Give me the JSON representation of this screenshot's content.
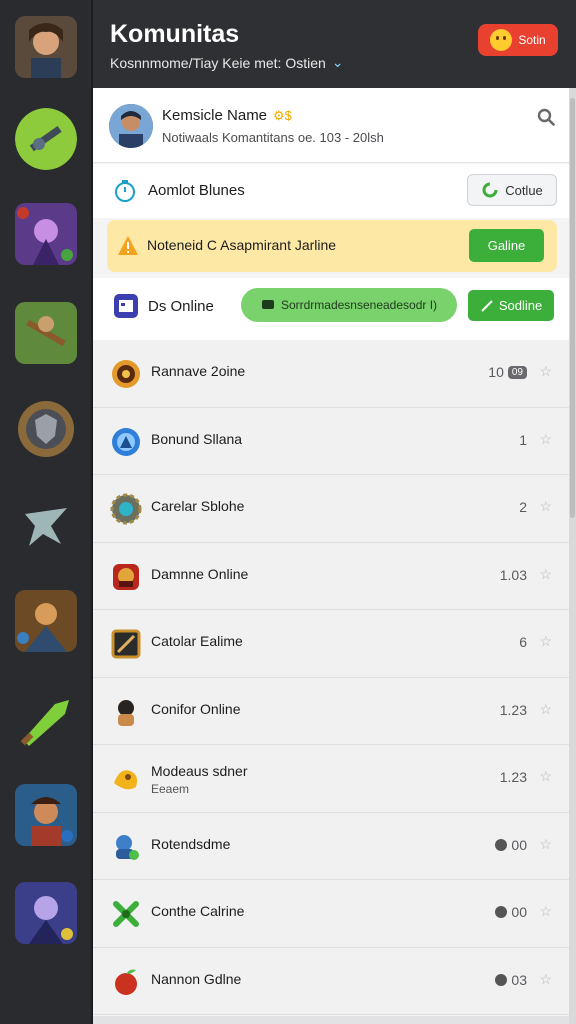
{
  "header": {
    "title": "Komunitas",
    "subtitle": "Kosnnmome/Tiay Keie met: Ostien",
    "action_label": "Sotin"
  },
  "rail": {
    "icons": [
      "hero-portrait-icon",
      "rifle-game-icon",
      "mage-hero-icon",
      "archer-game-icon",
      "shield-emblem-icon",
      "sword-emblem-icon",
      "warrior-game-icon",
      "green-blade-icon",
      "pirate-hero-icon",
      "lightning-hero-icon"
    ]
  },
  "profile": {
    "name": "Kemsicle Name",
    "badge": "⚙$",
    "sub": "Notiwaals Komantitans oe. 103 - 20lsh"
  },
  "controls": {
    "row1": {
      "label": "Aomlot Blunes",
      "button": "Cotlue"
    },
    "row2": {
      "label": "Noteneid C Asapmirant Jarline",
      "button": "Galine"
    },
    "row3": {
      "label": "Ds Online",
      "pill": "Sorrdrmadesnseneadesodr I)",
      "button": "Sodline"
    }
  },
  "list": [
    {
      "label": "Rannave 2oine",
      "count": "10",
      "tag": "09",
      "icon": "orange-orb-icon"
    },
    {
      "label": "Bonund Sllana",
      "count": "1",
      "icon": "blue-compass-icon"
    },
    {
      "label": "Carelar Sblohe",
      "count": "2",
      "icon": "teal-gear-icon"
    },
    {
      "label": "Damnne Online",
      "count": "1.03",
      "icon": "red-helmet-icon"
    },
    {
      "label": "Catolar Ealime",
      "count": "6",
      "icon": "arrow-card-icon"
    },
    {
      "label": "Conifor Online",
      "count": "1.23",
      "icon": "dark-character-icon"
    },
    {
      "label": "Modeaus sdner",
      "sub": "Eeaem",
      "count": "1.23",
      "icon": "gold-creature-icon"
    },
    {
      "label": "Rotendsdme",
      "count": "00",
      "dot": true,
      "icon": "blue-robot-icon"
    },
    {
      "label": "Conthe Calrine",
      "count": "00",
      "dot": true,
      "icon": "green-cross-icon"
    },
    {
      "label": "Nannon Gdlne",
      "count": "03",
      "dot": true,
      "icon": "red-apple-icon"
    }
  ],
  "colors": {
    "accent_green": "#3cae3a",
    "highlight": "#fde8a5",
    "header_bg": "#2f3033",
    "danger": "#e8412f"
  }
}
